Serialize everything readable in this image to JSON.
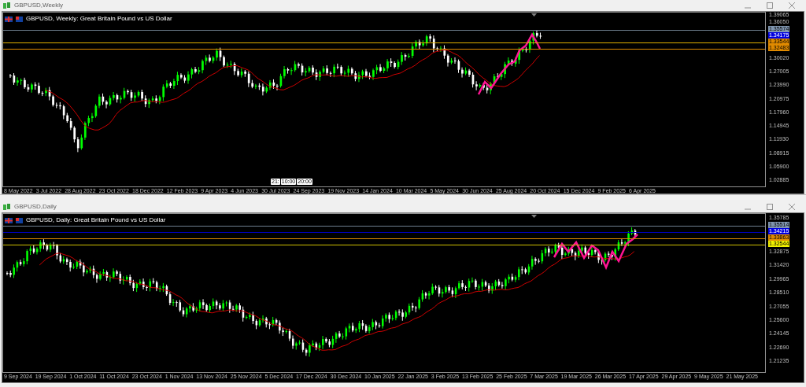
{
  "windows": [
    {
      "title": "GBPUSD,Weekly",
      "header": "GBPUSD, Weekly:  Great Britain Pound vs US Dollar",
      "price_labels": [
        "1.39065",
        "1.36050",
        "1.30020",
        "1.27005",
        "1.23990",
        "1.20975",
        "1.17960",
        "1.14945",
        "1.11930",
        "1.08915",
        "1.05900",
        "1.02885"
      ],
      "price_tags": [
        {
          "text": "1.35574",
          "color": "#8096b0"
        },
        {
          "text": "1.34175",
          "color": "#0000e0"
        },
        {
          "text": "1.33544",
          "color": "#e08a00"
        },
        {
          "text": "1.32483",
          "color": "#e08a00"
        }
      ],
      "date_labels": [
        "8 May 2022",
        "3 Jul 2022",
        "28 Aug 2022",
        "23 Oct 2022",
        "18 Dec 2022",
        "12 Feb 2023",
        "9 Apr 2023",
        "4 Jun 2023",
        "30 Jul 2023",
        "24 Sep 2023",
        "19 Nov 2023",
        "14 Jan 2024",
        "10 Mar 2024",
        "5 May 2024",
        "30 Jun 2024",
        "25 Aug 2024",
        "20 Oct 2024",
        "15 Dec 2024",
        "9 Feb 2025",
        "6 Apr 2025"
      ],
      "time_markers": [
        "21:",
        "10:00",
        "20:00"
      ]
    },
    {
      "title": "GBPUSD,Daily",
      "header": "GBPUSD, Daily:  Great Britain Pound vs US Dollar",
      "price_labels": [
        "1.35785",
        "1.32875",
        "1.31420",
        "1.29965",
        "1.28510",
        "1.27055",
        "1.25600",
        "1.24145",
        "1.22690",
        "1.21235"
      ],
      "price_tags": [
        {
          "text": "1.35514",
          "color": "#8096b0"
        },
        {
          "text": "1.34215",
          "color": "#0000e0"
        },
        {
          "text": "1.33863",
          "color": "#e08a00"
        },
        {
          "text": "1.32544",
          "color": "#f0f000"
        }
      ],
      "date_labels": [
        "9 Sep 2024",
        "19 Sep 2024",
        "1 Oct 2024",
        "11 Oct 2024",
        "23 Oct 2024",
        "1 Nov 2024",
        "13 Nov 2024",
        "25 Nov 2024",
        "5 Dec 2024",
        "17 Dec 2024",
        "30 Dec 2024",
        "10 Jan 2025",
        "22 Jan 2025",
        "3 Feb 2025",
        "13 Feb 2025",
        "25 Feb 2025",
        "7 Mar 2025",
        "19 Mar 2025",
        "26 Mar 2025",
        "17 Apr 2025",
        "29 Apr 2025",
        "9 May 2025",
        "21 May 2025"
      ]
    }
  ]
}
